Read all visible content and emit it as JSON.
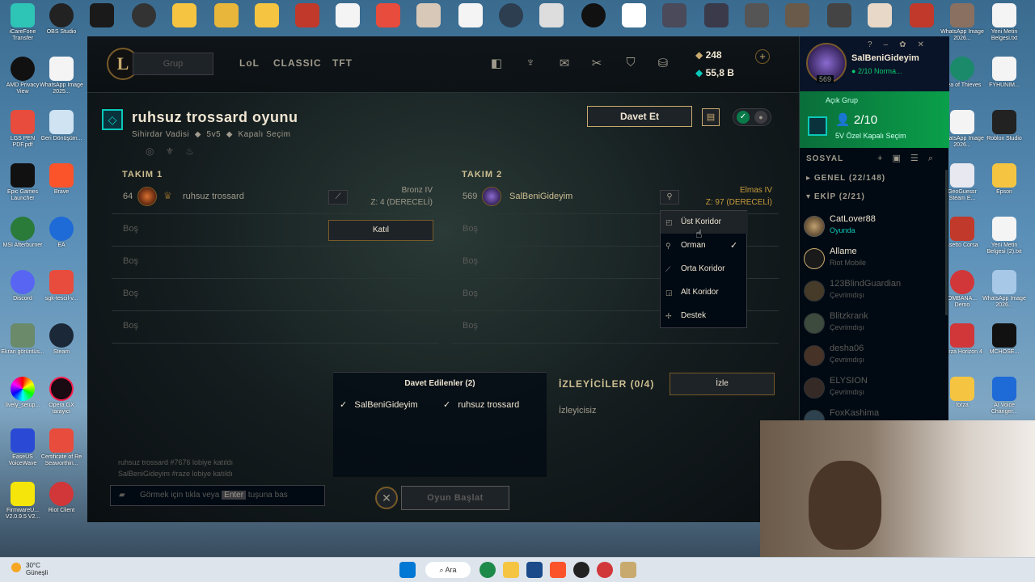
{
  "desktop": {
    "top_icons": [
      "iCareFone Transfer",
      "OBS Studio",
      "",
      "",
      "",
      "",
      "",
      "",
      "",
      "",
      "",
      "",
      "",
      "",
      "",
      "",
      "",
      "",
      "",
      "",
      "",
      "",
      "",
      "",
      "",
      "",
      "",
      "",
      "",
      "",
      "",
      "",
      "",
      "",
      "",
      "",
      "",
      "",
      "",
      "",
      "",
      "",
      "",
      "",
      "",
      "",
      "",
      "",
      "",
      "",
      "",
      "",
      "",
      "WhatsApp Image 2026...",
      "Yeni Metin Belgesi.txt"
    ],
    "left_icons": [
      "AMD Privacy View",
      "WhatsApp Image 2025...",
      "LGS PEN PDF.pdf",
      "Geri Dönüşüm...",
      "Epic Games Launcher",
      "Brave",
      "MSI Afterburner",
      "EA",
      "Discord",
      "sgk-tescil-v...",
      "Ekran görüntüs...",
      "Steam",
      "lively_setup...",
      "Opera GX tarayıcı",
      "EaseUS VoiceWave",
      "Certificate of Re Seaworthin...",
      "FirmwareU... V2.0.9.5 V2...",
      "Riot Client"
    ],
    "right_icons": [
      "Sea of Thieves",
      "FYHUNIM...",
      "WhatsApp Image 2026...",
      "Roblox Studio",
      "GeoGuessr Steam E...",
      "Epson",
      "ssetto Corsa",
      "Yeni Metin Belgesi (2).txt",
      "OMBANA... Demo",
      "WhatsApp Image 2026...",
      "Forza Horizon 4",
      "MCHOSE...",
      "forza",
      "AI Voice Changer..."
    ]
  },
  "client": {
    "logo_letter": "L",
    "grup_label": "Grup",
    "nav": [
      "LoL",
      "CLASSIC",
      "TFT"
    ],
    "currency": {
      "rp": "248",
      "be": "55,8 B"
    },
    "lobby": {
      "title": "ruhsuz trossard oyunu",
      "map": "Sihirdar Vadisi",
      "mode": "5v5",
      "pick": "Kapalı Seçim",
      "invite_label": "Davet Et"
    },
    "team1": {
      "label": "TAKIM 1",
      "player": {
        "level": "64",
        "name": "ruhsuz trossard",
        "rank": "Bronz IV",
        "lp": "Z: 4 (DERECELİ)"
      },
      "join_label": "Katıl",
      "empty_slots": [
        "Boş",
        "Boş",
        "Boş",
        "Boş"
      ]
    },
    "team2": {
      "label": "TAKIM 2",
      "player": {
        "level": "569",
        "name": "SalBeniGideyim",
        "rank": "Elmas IV",
        "lp": "Z: 97 (DERECELİ)"
      },
      "empty_slots": [
        "Boş",
        "Boş",
        "Boş",
        "Boş"
      ]
    },
    "position_menu": [
      {
        "label": "Üst Koridor",
        "icon": "top-lane-icon"
      },
      {
        "label": "Orman",
        "icon": "jungle-icon",
        "checked": true
      },
      {
        "label": "Orta Koridor",
        "icon": "mid-lane-icon"
      },
      {
        "label": "Alt Koridor",
        "icon": "bot-lane-icon"
      },
      {
        "label": "Destek",
        "icon": "support-icon"
      }
    ],
    "invited": {
      "title": "Davet Edilenler (2)",
      "names": [
        "SalBeniGideyim",
        "ruhsuz trossard"
      ]
    },
    "spectators": {
      "title": "İZLEYİCİLER (0/4)",
      "empty": "İzleyicisiz",
      "watch_label": "İzle"
    },
    "chat_log": [
      "ruhsuz trossard #7676 lobiye katıldı",
      "SalBeniGideyim #raze lobiye katıldı"
    ],
    "chat_input": {
      "before": "Görmek için tıkla veya",
      "key": "Enter",
      "after": "tuşuna bas"
    },
    "start_label": "Oyun Başlat"
  },
  "social": {
    "profile": {
      "name": "SalBeniGideyim",
      "level": "569",
      "status": "2/10 Norma..."
    },
    "group": {
      "label": "Açık Grup",
      "count": "2/10",
      "mode": "5V Özel Kapalı Seçim"
    },
    "header": "SOSYAL",
    "groups": [
      {
        "label": "GENEL (22/148)",
        "collapsed": true
      },
      {
        "label": "EKİP (2/21)",
        "collapsed": false
      }
    ],
    "friends": [
      {
        "name": "CatLover88",
        "status": "Oyunda",
        "online": true
      },
      {
        "name": "Allame",
        "status": "Riot Mobile",
        "online": true
      },
      {
        "name": "123BlindGuardian",
        "status": "Çevrimdışı",
        "online": false
      },
      {
        "name": "Blitzkrank",
        "status": "Çevrimdışı",
        "online": false
      },
      {
        "name": "desha06",
        "status": "Çevrimdışı",
        "online": false
      },
      {
        "name": "ELYSION",
        "status": "Çevrimdışı",
        "online": false
      },
      {
        "name": "FoxKashima",
        "status": "",
        "online": false
      }
    ]
  },
  "taskbar": {
    "weather_temp": "30°C",
    "weather_text": "Güneşli",
    "search_label": "Ara"
  },
  "colors": {
    "gold": "#c8aa6e",
    "teal": "#0ac8b9",
    "online_green": "#0acb6e",
    "rank_gold": "#c89b3c"
  }
}
